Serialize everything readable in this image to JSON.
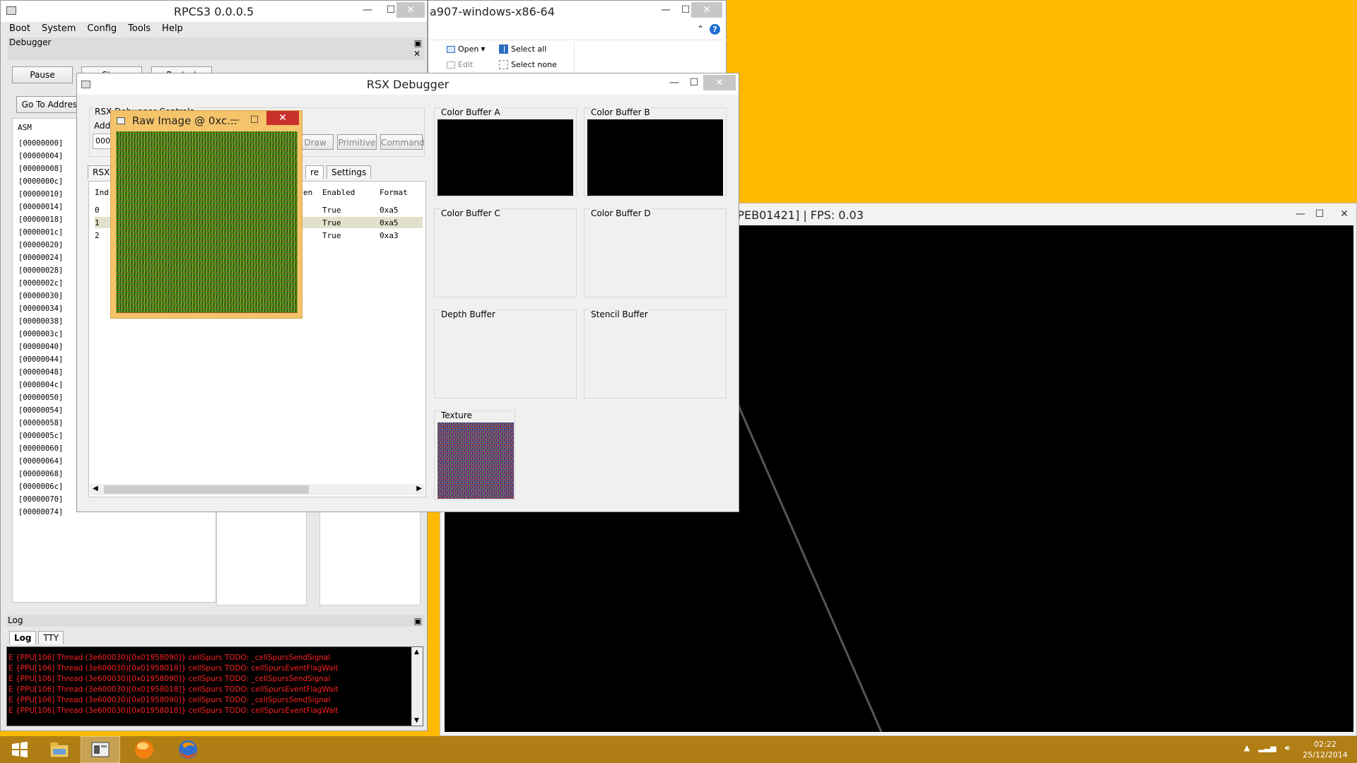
{
  "rpcs3": {
    "title": "RPCS3 0.0.0.5",
    "menu": [
      "Boot",
      "System",
      "Config",
      "Tools",
      "Help"
    ],
    "debugger_panel_title": "Debugger",
    "buttons": {
      "pause": "Pause",
      "stop": "Stop",
      "restart": "Restart",
      "goto": "Go To Address"
    },
    "asm_header": "ASM",
    "asm_addresses": [
      "[00000000]",
      "[00000004]",
      "[00000008]",
      "[0000000c]",
      "[00000010]",
      "[00000014]",
      "[00000018]",
      "[0000001c]",
      "[00000020]",
      "[00000024]",
      "[00000028]",
      "[0000002c]",
      "[00000030]",
      "[00000034]",
      "[00000038]",
      "[0000003c]",
      "[00000040]",
      "[00000044]",
      "[00000048]",
      "[0000004c]",
      "[00000050]",
      "[00000054]",
      "[00000058]",
      "[0000005c]",
      "[00000060]",
      "[00000064]",
      "[00000068]",
      "[0000006c]",
      "[00000070]",
      "[00000074]"
    ],
    "log_panel_title": "Log",
    "log_tabs": [
      "Log",
      "TTY"
    ],
    "log_lines": [
      "E {PPU[106] Thread (3e600030)[0x01958090]} cellSpurs TODO: _cellSpursSendSignal",
      "E {PPU[106] Thread (3e600030)[0x01958018]} cellSpurs TODO: cellSpursEventFlagWait",
      "E {PPU[106] Thread (3e600030)[0x01958090]} cellSpurs TODO: _cellSpursSendSignal",
      "E {PPU[106] Thread (3e600030)[0x01958018]} cellSpurs TODO: cellSpursEventFlagWait",
      "E {PPU[106] Thread (3e600030)[0x01958090]} cellSpurs TODO: _cellSpursSendSignal",
      "E {PPU[106] Thread (3e600030)[0x01958018]} cellSpurs TODO: cellSpursEventFlagWait"
    ]
  },
  "explorer": {
    "title": "a907-windows-x86-64",
    "open": "Open",
    "edit": "Edit",
    "select_all": "Select all",
    "select_none": "Select none"
  },
  "rsx": {
    "title": "RSX Debugger",
    "controls_label": "RSX Debugger Controls",
    "addr_label": "Add",
    "addr_value": "000",
    "draw_btn": "Draw",
    "primitive_btn": "Primitive",
    "command_btn": "Command",
    "tab_first": "RSX C",
    "tab_active_suffix": "re",
    "tab_settings": "Settings",
    "table_headers": [
      "Ind",
      "en",
      "Enabled",
      "Format"
    ],
    "rows": [
      {
        "index": "0",
        "enabled": "True",
        "format": "0xa5"
      },
      {
        "index": "1",
        "enabled": "True",
        "format": "0xa5"
      },
      {
        "index": "2",
        "enabled": "True",
        "format": "0xa3"
      }
    ],
    "buffers": {
      "a": "Color Buffer A",
      "b": "Color Buffer B",
      "c": "Color Buffer C",
      "d": "Color Buffer D",
      "depth": "Depth Buffer",
      "stencil": "Stencil Buffer",
      "texture": "Texture"
    }
  },
  "raw_image": {
    "title": "Raw Image @ 0xc..."
  },
  "proteus": {
    "title": "Proteus [NPEB01421] | FPS: 0.03"
  },
  "taskbar": {
    "time": "02:22",
    "date": "25/12/2014"
  },
  "colors": {
    "desktop": "#ffb900",
    "raw_frame": "#f5c46a",
    "close_red": "#c9302c",
    "log_red": "#ff0000"
  }
}
